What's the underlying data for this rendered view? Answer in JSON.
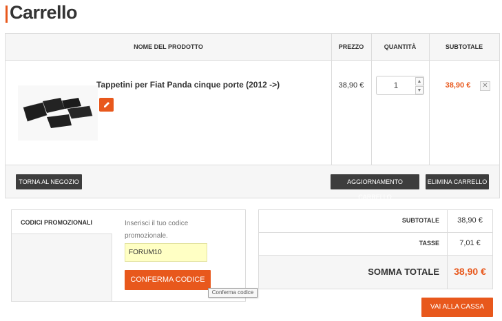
{
  "page": {
    "title": "Carrello"
  },
  "table": {
    "headers": {
      "product": "NOME DEL PRODOTTO",
      "price": "PREZZO",
      "quantity": "QUANTITÀ",
      "subtotal": "SUBTOTALE"
    },
    "items": [
      {
        "name": "Tappetini per Fiat Panda cinque porte (2012 ->)",
        "price": "38,90 €",
        "quantity": "1",
        "subtotal": "38,90 €",
        "image": "car-floor-mats"
      }
    ],
    "footer": {
      "back_label": "TORNA AL NEGOZIO",
      "update_label": "AGGIORNAMENTO CARRELLO",
      "clear_label": "ELIMINA CARRELLO"
    }
  },
  "promo": {
    "title": "CODICI PROMOZIONALI",
    "instructions": "Inserisci il tuo codice promozionale.",
    "code_value": "FORUM10",
    "confirm_label": "CONFERMA CODICE",
    "tooltip": "Conferma codice"
  },
  "totals": {
    "subtotal_label": "SUBTOTALE",
    "subtotal_value": "38,90 €",
    "tax_label": "TASSE",
    "tax_value": "7,01 €",
    "grand_label": "SOMMA TOTALE",
    "grand_value": "38,90 €"
  },
  "checkout": {
    "label": "VAI ALLA CASSA"
  },
  "colors": {
    "accent": "#e8581c",
    "dark_button": "#3d3d3d",
    "promo_field": "#ffffc4"
  }
}
